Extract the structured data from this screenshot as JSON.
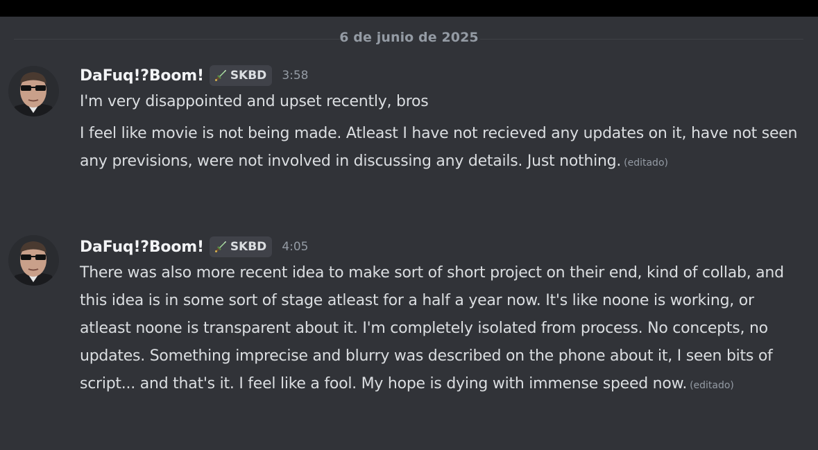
{
  "date_divider": "6 de junio de 2025",
  "messages": [
    {
      "username": "DaFuq!?Boom!",
      "tag": "SKBD",
      "tag_icon": "sword-icon",
      "timestamp": "3:58",
      "paragraphs": [
        {
          "text": "I'm very disappointed and upset recently, bros",
          "edited": ""
        },
        {
          "text": "I feel like movie is not being made. Atleast I have not recieved any updates on it, have not seen any previsions, were not involved in discussing any details. Just nothing.",
          "edited": "(editado)"
        }
      ]
    },
    {
      "username": "DaFuq!?Boom!",
      "tag": "SKBD",
      "tag_icon": "sword-icon",
      "timestamp": "4:05",
      "paragraphs": [
        {
          "text": "There was also more recent idea to make sort of short project on their end, kind of collab, and this idea is in some sort of stage atleast for a half a year now. It's like noone is working, or atleast noone is transparent about it. I'm completely isolated from process. No concepts, no updates. Something imprecise and blurry was described on the phone about it, I seen bits of script... and that's it. I feel like a fool. My hope is dying with immense speed now.",
          "edited": "(editado)"
        }
      ]
    }
  ],
  "colors": {
    "background": "#313338",
    "text": "#dbdee1",
    "username": "#f2f3f5",
    "muted": "#949ba4",
    "tag_bg": "#404249"
  }
}
